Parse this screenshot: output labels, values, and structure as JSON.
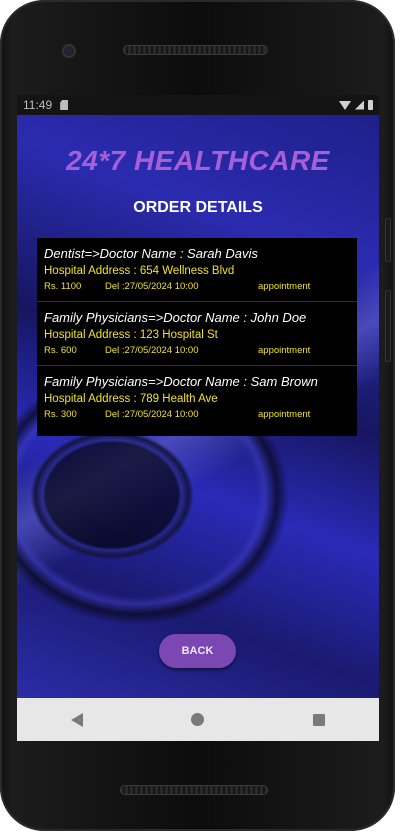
{
  "statusbar": {
    "time": "11:49"
  },
  "app": {
    "title": "24*7 HEALTHCARE",
    "subtitle": "ORDER DETAILS"
  },
  "orders": [
    {
      "doctor": "Dentist=>Doctor Name : Sarah Davis",
      "address": "Hospital Address : 654 Wellness Blvd",
      "price": "Rs. 1100",
      "delivery": "Del :27/05/2024 10:00",
      "type": "appointment"
    },
    {
      "doctor": "Family Physicians=>Doctor Name : John Doe",
      "address": "Hospital Address : 123 Hospital St",
      "price": "Rs. 600",
      "delivery": "Del :27/05/2024 10:00",
      "type": "appointment"
    },
    {
      "doctor": "Family Physicians=>Doctor Name : Sam Brown",
      "address": "Hospital Address : 789 Health Ave",
      "price": "Rs. 300",
      "delivery": "Del :27/05/2024 10:00",
      "type": "appointment"
    }
  ],
  "buttons": {
    "back_label": "BACK"
  },
  "icons": {
    "status": [
      "sd-card-icon",
      "wifi-icon",
      "signal-icon",
      "battery-icon"
    ],
    "navbar": [
      "nav-back-icon",
      "nav-home-icon",
      "nav-recent-icon"
    ]
  },
  "colors": {
    "title": "#a560d8",
    "text_yellow": "#f2e22a",
    "button": "#7a47b3"
  }
}
